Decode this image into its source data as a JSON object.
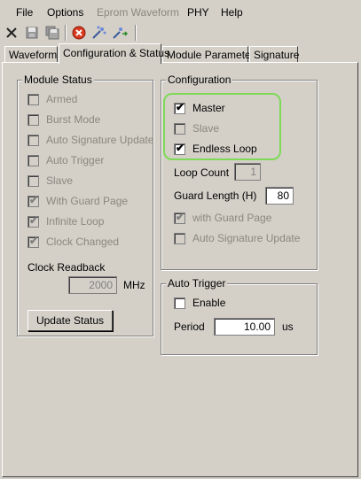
{
  "menu": {
    "file": "File",
    "options": "Options",
    "eprom": "Eprom Waveform",
    "phy": "PHY",
    "help": "Help"
  },
  "toolbar": {
    "icons": [
      "close-x-icon",
      "save-icon",
      "save-all-icon",
      "stop-icon",
      "wand-icon",
      "wand-arrow-icon"
    ]
  },
  "tabs": {
    "waveform": "Waveform",
    "config_status": "Configuration & Status",
    "module_parameter": "Module Parameter",
    "signature": "Signature"
  },
  "module_status": {
    "title": "Module Status",
    "items": [
      {
        "label": "Armed",
        "checked": false
      },
      {
        "label": "Burst Mode",
        "checked": false
      },
      {
        "label": "Auto Signature Update",
        "checked": false
      },
      {
        "label": "Auto Trigger",
        "checked": false
      },
      {
        "label": "Slave",
        "checked": false
      },
      {
        "label": "With Guard Page",
        "checked": true
      },
      {
        "label": "Infinite Loop",
        "checked": true
      },
      {
        "label": "Clock Changed",
        "checked": true
      }
    ],
    "clock_label": "Clock Readback",
    "clock_value": "2000",
    "clock_unit": "MHz",
    "update_button": "Update Status"
  },
  "configuration": {
    "title": "Configuration",
    "master": "Master",
    "slave": "Slave",
    "endless_loop": "Endless Loop",
    "loop_count_label": "Loop Count",
    "loop_count_value": "1",
    "guard_length_label": "Guard Length (H)",
    "guard_length_value": "80",
    "with_guard_page": "with Guard Page",
    "auto_signature": "Auto Signature Update"
  },
  "auto_trigger": {
    "title": "Auto Trigger",
    "enable": "Enable",
    "period_label": "Period",
    "period_value": "10.00",
    "period_unit": "us"
  },
  "check_mark": "✔",
  "colors": {
    "background": "#d4d0c8",
    "highlight": "#7ed957",
    "stop_red": "#d83a1f"
  }
}
